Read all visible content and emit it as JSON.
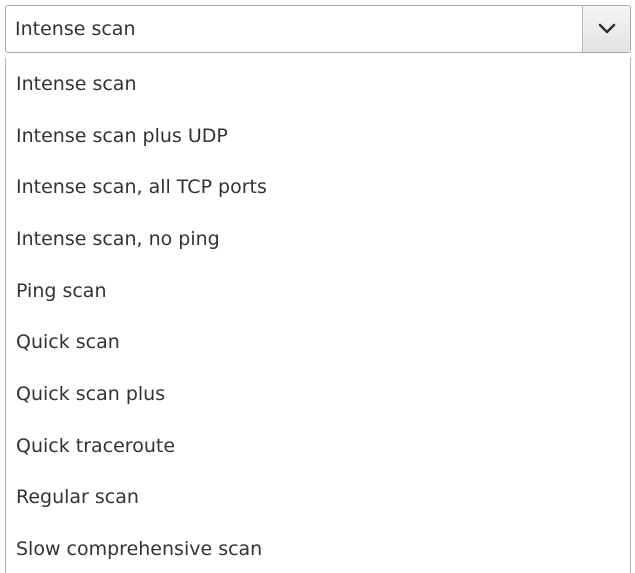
{
  "combo": {
    "selected_value": "Intense scan",
    "button_icon": "chevron-down-icon"
  },
  "dropdown": {
    "options": [
      "Intense scan",
      "Intense scan plus UDP",
      "Intense scan, all TCP ports",
      "Intense scan, no ping",
      "Ping scan",
      "Quick scan",
      "Quick scan plus",
      "Quick traceroute",
      "Regular scan",
      "Slow comprehensive scan"
    ]
  }
}
